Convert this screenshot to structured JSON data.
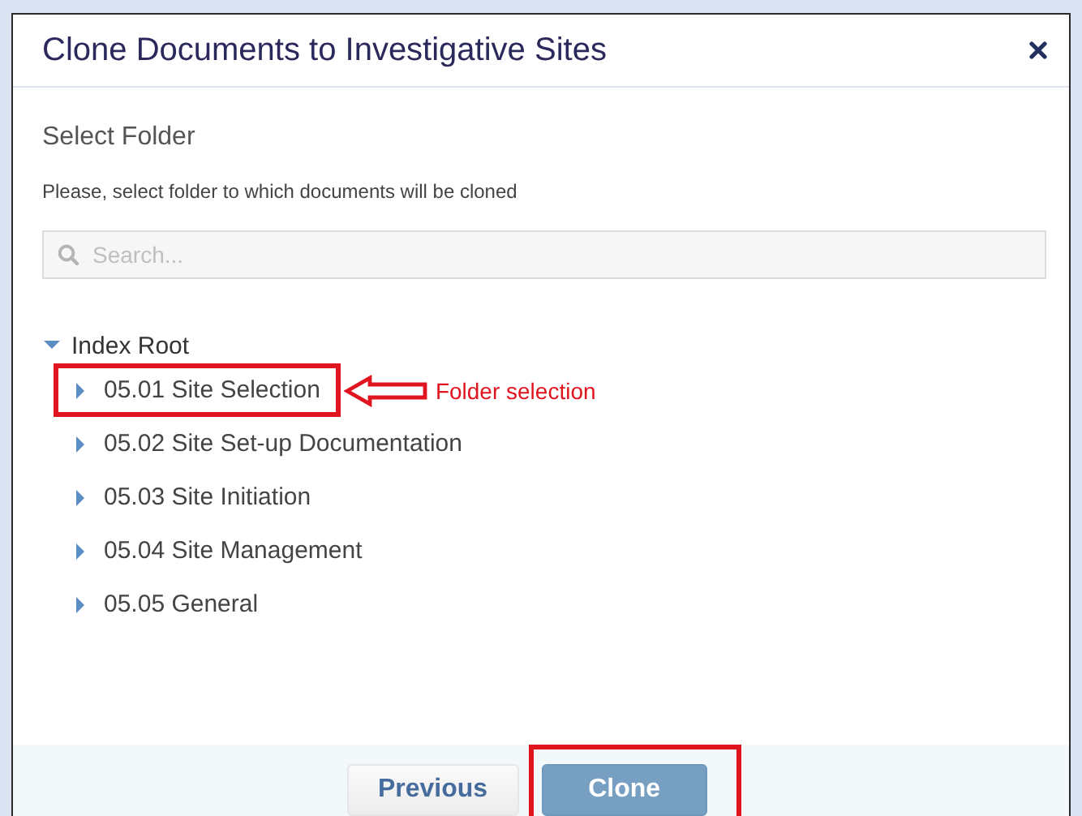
{
  "dialog": {
    "title": "Clone Documents to Investigative Sites"
  },
  "section_title": "Select Folder",
  "instruction": "Please, select folder to which documents will be cloned",
  "search": {
    "placeholder": "Search..."
  },
  "tree": {
    "label": "Index Root",
    "expanded": true,
    "children": [
      {
        "label": "05.01 Site Selection",
        "expanded": false,
        "highlighted": true,
        "callout": "Folder selection"
      },
      {
        "label": "05.02 Site Set-up Documentation",
        "expanded": false,
        "highlighted": false
      },
      {
        "label": "05.03 Site Initiation",
        "expanded": false,
        "highlighted": false
      },
      {
        "label": "05.04 Site Management",
        "expanded": false,
        "highlighted": false
      },
      {
        "label": "05.05 General",
        "expanded": false,
        "highlighted": false
      }
    ]
  },
  "buttons": [
    {
      "label": "Previous",
      "kind": "secondary",
      "highlighted": false
    },
    {
      "label": "Clone",
      "kind": "primary",
      "highlighted": true
    }
  ]
}
